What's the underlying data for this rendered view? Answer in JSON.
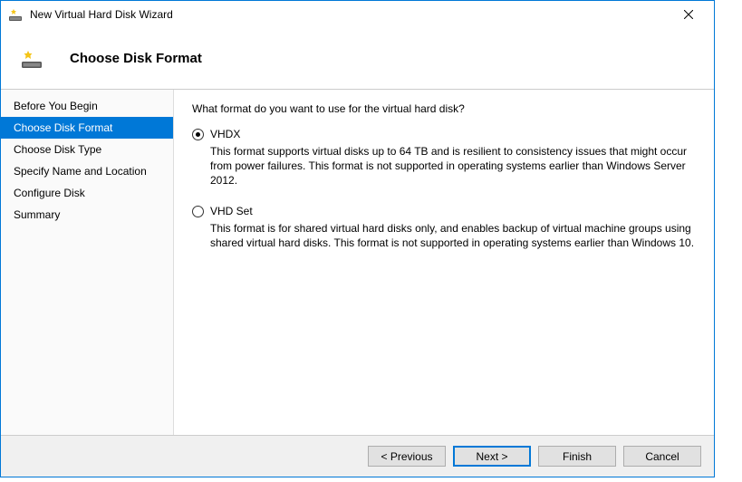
{
  "window": {
    "title": "New Virtual Hard Disk Wizard"
  },
  "header": {
    "title": "Choose Disk Format"
  },
  "sidebar": {
    "items": [
      {
        "label": "Before You Begin",
        "selected": false
      },
      {
        "label": "Choose Disk Format",
        "selected": true
      },
      {
        "label": "Choose Disk Type",
        "selected": false
      },
      {
        "label": "Specify Name and Location",
        "selected": false
      },
      {
        "label": "Configure Disk",
        "selected": false
      },
      {
        "label": "Summary",
        "selected": false
      }
    ]
  },
  "content": {
    "prompt": "What format do you want to use for the virtual hard disk?",
    "options": [
      {
        "label": "VHDX",
        "checked": true,
        "description": "This format supports virtual disks up to 64 TB and is resilient to consistency issues that might occur from power failures. This format is not supported in operating systems earlier than Windows Server 2012."
      },
      {
        "label": "VHD Set",
        "checked": false,
        "description": "This format is for shared virtual hard disks only, and enables backup of virtual machine groups using shared virtual hard disks. This format is not supported in operating systems earlier than Windows 10."
      }
    ]
  },
  "footer": {
    "previous": "< Previous",
    "next": "Next >",
    "finish": "Finish",
    "cancel": "Cancel"
  }
}
